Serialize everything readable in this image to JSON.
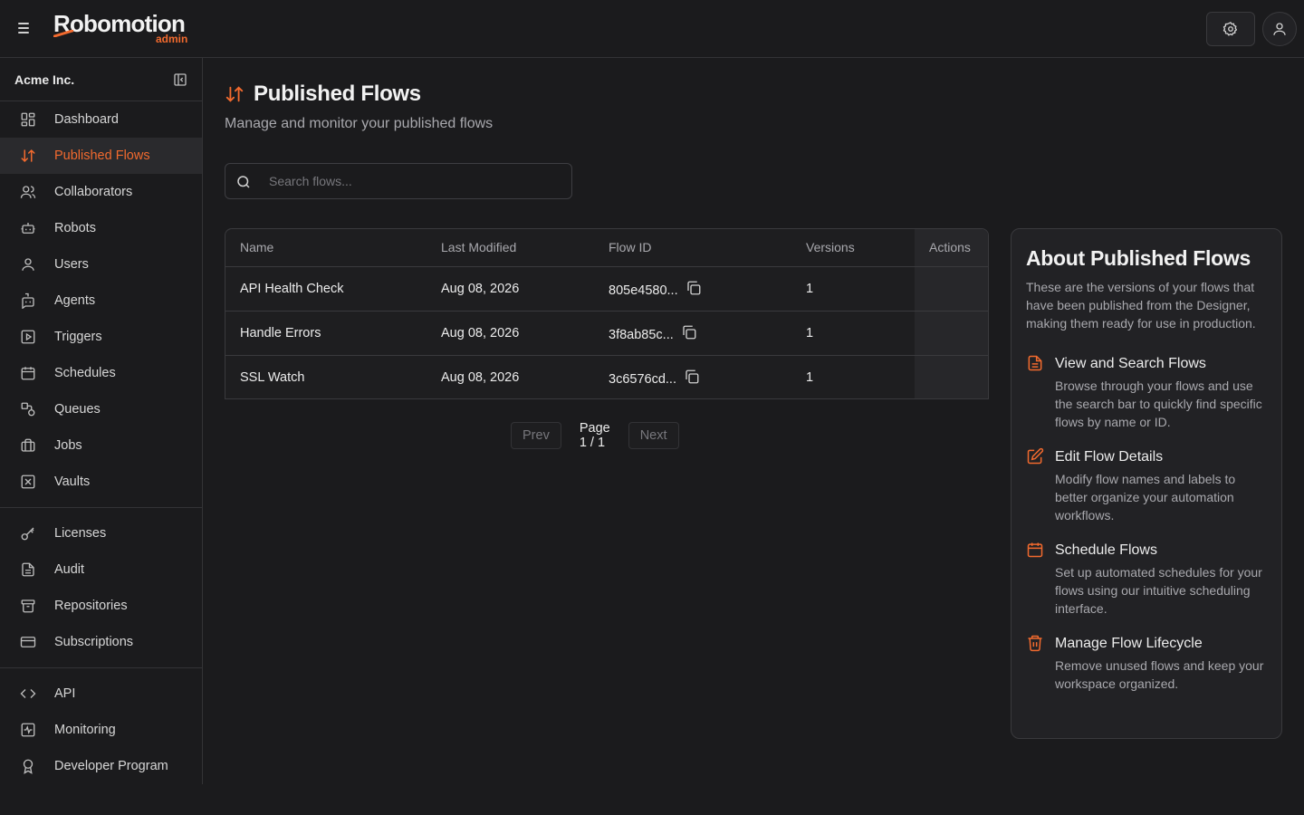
{
  "app": {
    "logo_text": "Robomotion",
    "logo_sub": "admin",
    "accent": "#f26a2e"
  },
  "header": {
    "menu_icon": "hamburger-icon",
    "settings_icon": "gear-icon",
    "user_icon": "user-icon"
  },
  "sidebar": {
    "org_name": "Acme Inc.",
    "groups": [
      [
        {
          "label": "Dashboard",
          "icon": "dashboard-icon"
        },
        {
          "label": "Published Flows",
          "icon": "arrows-up-down-icon",
          "active": true
        },
        {
          "label": "Collaborators",
          "icon": "users-icon"
        },
        {
          "label": "Robots",
          "icon": "robot-icon"
        },
        {
          "label": "Users",
          "icon": "user-icon"
        },
        {
          "label": "Agents",
          "icon": "bot-message-icon"
        },
        {
          "label": "Triggers",
          "icon": "play-square-icon"
        },
        {
          "label": "Schedules",
          "icon": "calendar-icon"
        },
        {
          "label": "Queues",
          "icon": "shapes-icon"
        },
        {
          "label": "Jobs",
          "icon": "briefcase-icon"
        },
        {
          "label": "Vaults",
          "icon": "vault-icon"
        }
      ],
      [
        {
          "label": "Licenses",
          "icon": "key-icon"
        },
        {
          "label": "Audit",
          "icon": "file-text-icon"
        },
        {
          "label": "Repositories",
          "icon": "archive-icon"
        },
        {
          "label": "Subscriptions",
          "icon": "credit-card-icon"
        }
      ],
      [
        {
          "label": "API",
          "icon": "code-icon"
        },
        {
          "label": "Monitoring",
          "icon": "activity-icon"
        },
        {
          "label": "Developer Program",
          "icon": "award-icon"
        }
      ]
    ]
  },
  "main": {
    "title": "Published Flows",
    "subtitle": "Manage and monitor your published flows",
    "search_placeholder": "Search flows...",
    "table": {
      "columns": [
        "Name",
        "Last Modified",
        "Flow ID",
        "Versions",
        "Actions"
      ],
      "rows": [
        {
          "name": "API Health Check",
          "modified": "Aug 08, 2026",
          "flow_id": "805e4580...",
          "versions": "1"
        },
        {
          "name": "Handle Errors",
          "modified": "Aug 08, 2026",
          "flow_id": "3f8ab85c...",
          "versions": "1"
        },
        {
          "name": "SSL Watch",
          "modified": "Aug 08, 2026",
          "flow_id": "3c6576cd...",
          "versions": "1"
        }
      ]
    },
    "pager": {
      "prev": "Prev",
      "label": "Page 1 / 1",
      "next": "Next"
    }
  },
  "about": {
    "title": "About Published Flows",
    "description": "These are the versions of your flows that have been published from the Designer, making them ready for use in production.",
    "features": [
      {
        "icon": "file-text-icon",
        "title": "View and Search Flows",
        "desc": "Browse through your flows and use the search bar to quickly find specific flows by name or ID."
      },
      {
        "icon": "edit-icon",
        "title": "Edit Flow Details",
        "desc": "Modify flow names and labels to better organize your automation workflows."
      },
      {
        "icon": "calendar-icon",
        "title": "Schedule Flows",
        "desc": "Set up automated schedules for your flows using our intuitive scheduling interface."
      },
      {
        "icon": "trash-icon",
        "title": "Manage Flow Lifecycle",
        "desc": "Remove unused flows and keep your workspace organized."
      }
    ]
  }
}
